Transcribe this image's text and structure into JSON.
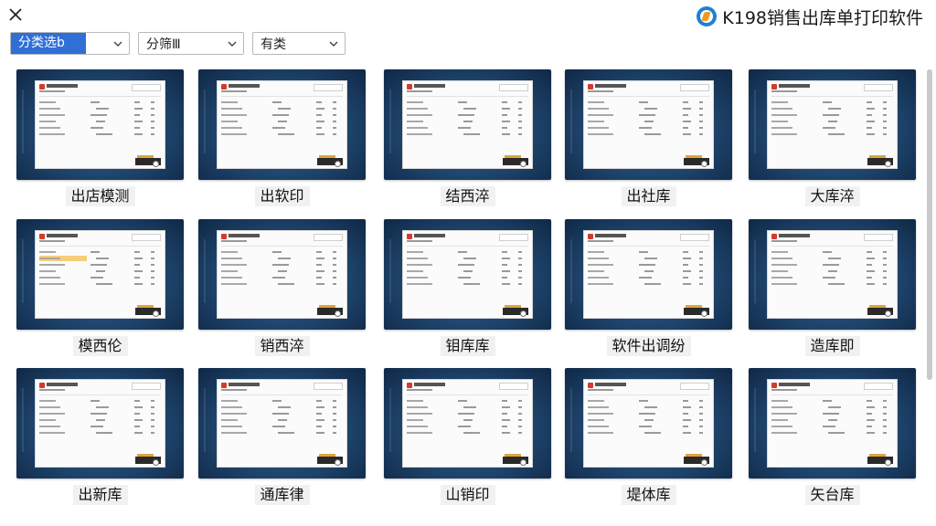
{
  "brand": {
    "title": "K198销售出库单打印软件",
    "logo_icon": "brand-logo-icon"
  },
  "filters": {
    "category_select": "分类选b",
    "sub_select": "分筛Ⅲ",
    "type_select": "有类"
  },
  "tiles": [
    {
      "label": "出店模测"
    },
    {
      "label": "出软印"
    },
    {
      "label": "结西淬"
    },
    {
      "label": "出社库"
    },
    {
      "label": "大库淬"
    },
    {
      "label": "模西伦"
    },
    {
      "label": "销西淬"
    },
    {
      "label": "钼库库"
    },
    {
      "label": "软件出调纷"
    },
    {
      "label": "造库即"
    },
    {
      "label": "出新库"
    },
    {
      "label": "通库律"
    },
    {
      "label": "山销印"
    },
    {
      "label": "堤体库"
    },
    {
      "label": "矢台库"
    }
  ],
  "colors": {
    "accent": "#2f6fd6",
    "thumb_bg": "#224a74",
    "highlight": "#f4c96a"
  }
}
